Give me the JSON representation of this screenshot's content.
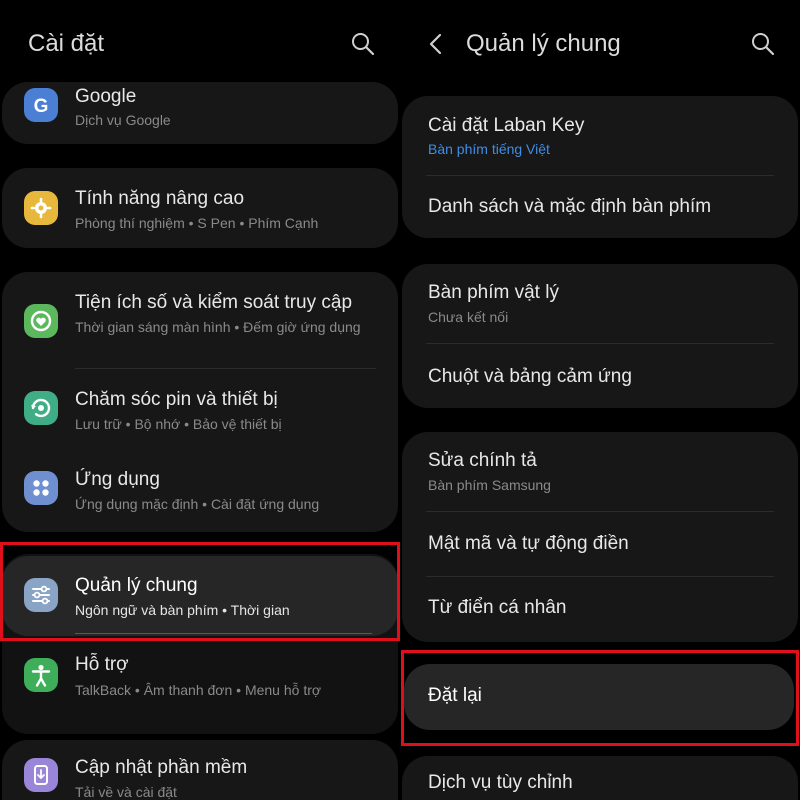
{
  "left": {
    "title": "Cài đặt",
    "items": [
      {
        "title": "Google",
        "subtitle": "Dịch vụ Google",
        "icon": "google-icon"
      },
      {
        "title": "Tính năng nâng cao",
        "subtitle": "Phòng thí nghiệm  •  S Pen  •  Phím Cạnh",
        "icon": "advanced-features-icon"
      },
      {
        "title": "Tiện ích số và kiểm soát truy cập",
        "subtitle": "Thời gian sáng màn hình  •  Đếm giờ ứng dụng",
        "icon": "digital-wellbeing-icon"
      },
      {
        "title": "Chăm sóc pin và thiết bị",
        "subtitle": "Lưu trữ  •  Bộ nhớ  •  Bảo vệ thiết bị",
        "icon": "device-care-icon"
      },
      {
        "title": "Ứng dụng",
        "subtitle": "Ứng dụng mặc định  •  Cài đặt ứng dụng",
        "icon": "apps-icon"
      },
      {
        "title": "Quản lý chung",
        "subtitle": "Ngôn ngữ và bàn phím  •  Thời gian",
        "icon": "general-management-icon"
      },
      {
        "title": "Hỗ trợ",
        "subtitle": "TalkBack  •  Âm thanh đơn  •  Menu hỗ trợ",
        "icon": "accessibility-icon"
      },
      {
        "title": "Cập nhật phần mềm",
        "subtitle": "Tải về và cài đặt",
        "icon": "software-update-icon"
      }
    ]
  },
  "right": {
    "title": "Quản lý chung",
    "items": [
      {
        "title": "Cài đặt Laban Key",
        "subtitle": "Bàn phím tiếng Việt"
      },
      {
        "title": "Danh sách và mặc định bàn phím"
      },
      {
        "title": "Bàn phím vật lý",
        "subtitle": "Chưa kết nối"
      },
      {
        "title": "Chuột và bảng cảm ứng"
      },
      {
        "title": "Sửa chính tả",
        "subtitle": "Bàn phím Samsung"
      },
      {
        "title": "Mật mã và tự động điền"
      },
      {
        "title": "Từ điển cá nhân"
      },
      {
        "title": "Đặt lại"
      },
      {
        "title": "Dịch vụ tùy chỉnh"
      }
    ]
  },
  "colors": {
    "background": "#000000",
    "card": "#171717",
    "highlight_border": "#e0101a",
    "link_subtitle": "#3e8ee8",
    "google_icon": "#4a7fd3",
    "advanced_icon": "#e8b83c",
    "wellbeing_icon": "#5cb85c",
    "device_care_icon": "#3fae86",
    "apps_icon": "#6f8fd0",
    "general_icon": "#8aa4c6",
    "accessibility_icon": "#3fae5a",
    "update_icon": "#9a86d8"
  }
}
